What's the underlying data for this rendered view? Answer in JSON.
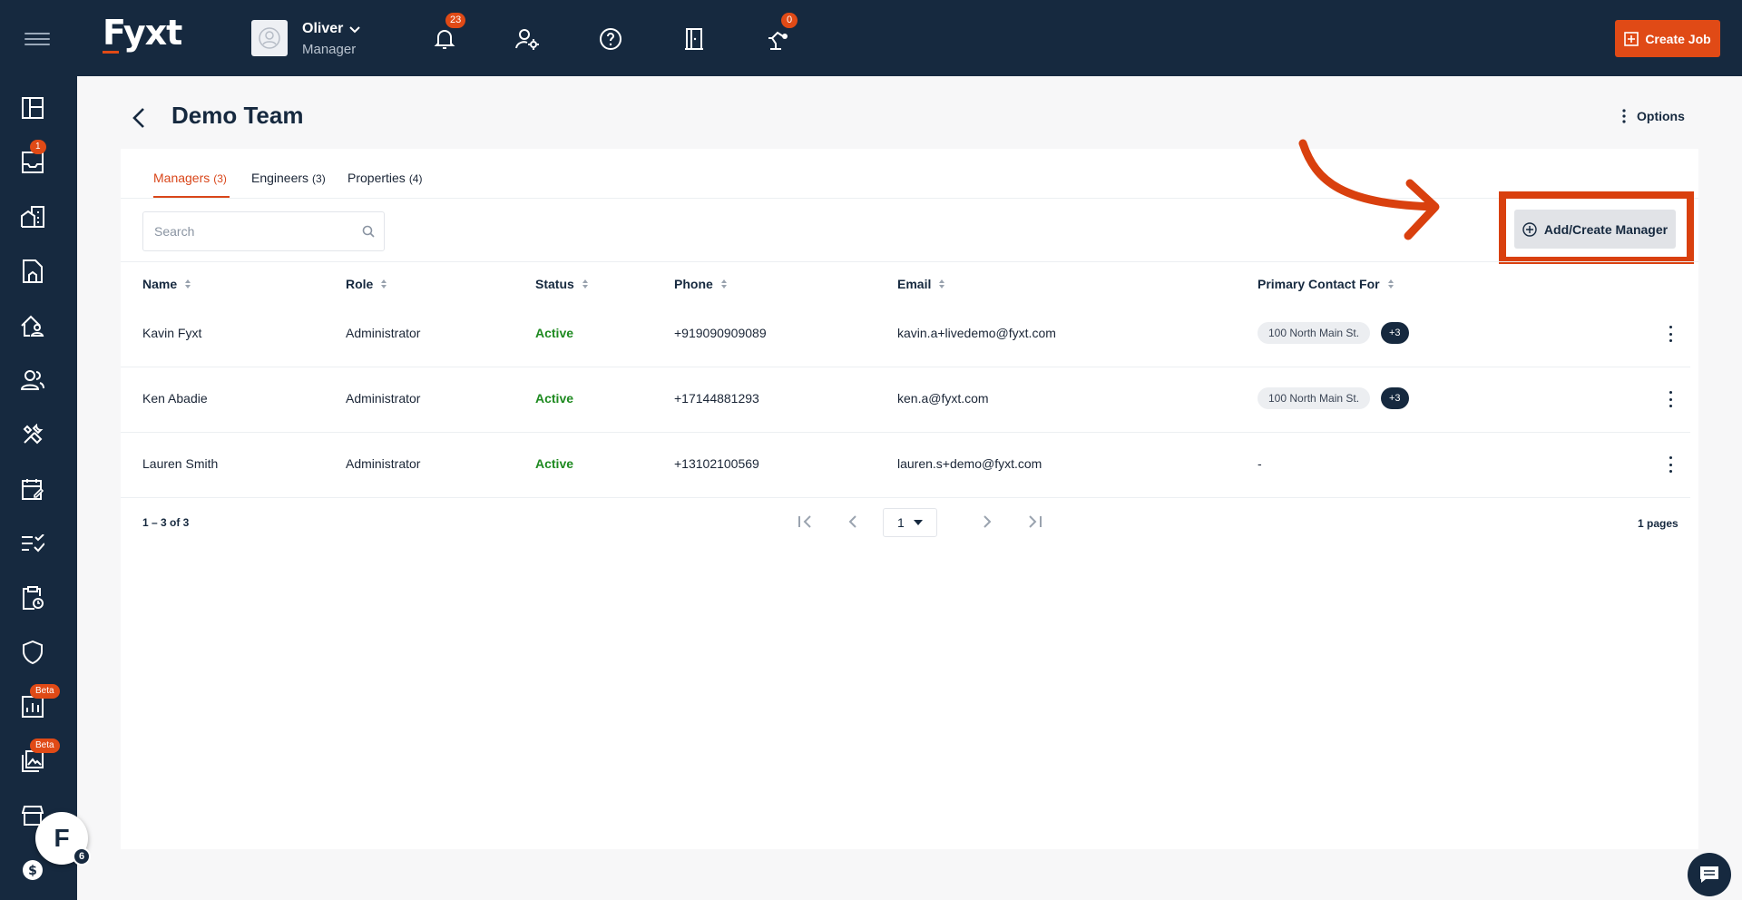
{
  "app": {
    "logo": "Fyxt"
  },
  "user": {
    "name": "Oliver",
    "role": "Manager"
  },
  "topbar": {
    "notifications_count": "23",
    "robot_count": "0",
    "create_job_label": "Create Job"
  },
  "sidebar": {
    "inbox_badge": "1",
    "reports_badge": "Beta",
    "gallery_badge": "Beta",
    "chat_count": "6"
  },
  "page": {
    "title": "Demo Team",
    "options_label": "Options"
  },
  "tabs": [
    {
      "label": "Managers",
      "count": "(3)"
    },
    {
      "label": "Engineers",
      "count": "(3)"
    },
    {
      "label": "Properties",
      "count": "(4)"
    }
  ],
  "search": {
    "placeholder": "Search"
  },
  "add_button_label": "Add/Create Manager",
  "table": {
    "headers": [
      "Name",
      "Role",
      "Status",
      "Phone",
      "Email",
      "Primary Contact For"
    ],
    "rows": [
      {
        "name": "Kavin Fyxt",
        "role": "Administrator",
        "status": "Active",
        "phone": "+919090909089",
        "email": "kavin.a+livedemo@fyxt.com",
        "primary": "100 North Main St.",
        "more": "+3"
      },
      {
        "name": "Ken Abadie",
        "role": "Administrator",
        "status": "Active",
        "phone": "+17144881293",
        "email": "ken.a@fyxt.com",
        "primary": "100 North Main St.",
        "more": "+3"
      },
      {
        "name": "Lauren Smith",
        "role": "Administrator",
        "status": "Active",
        "phone": "+13102100569",
        "email": "lauren.s+demo@fyxt.com",
        "primary": "-",
        "more": ""
      }
    ]
  },
  "pagination": {
    "range": "1 – 3 of 3",
    "current_page": "1",
    "pages_label": "1 pages"
  },
  "colors": {
    "navy": "#16293f",
    "accent": "#e04a16",
    "active_green": "#1e8a20",
    "annotation_red": "#d9400e"
  }
}
